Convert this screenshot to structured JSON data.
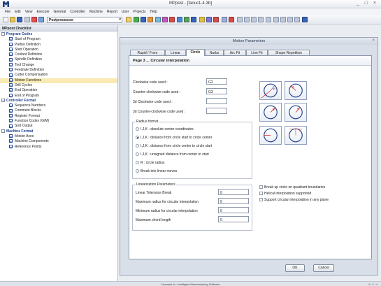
{
  "window": {
    "title": "MPpost - [fanuc1-4-3b]",
    "controls": "_ □ ×"
  },
  "menu": [
    "File",
    "Edit",
    "View",
    "Execute",
    "General",
    "Controller",
    "Machine",
    "Report",
    "User",
    "Projects",
    "Help"
  ],
  "toolbar": {
    "postprocessor_combo": "Postprocessor"
  },
  "left_panel": {
    "title": "MPpost Checklist",
    "groups": [
      {
        "label": "Program Codes",
        "items": [
          "Start of Program",
          "Partno Definition",
          "Start Operation",
          "Coolant Definition",
          "Spindle Definition",
          "Tool Change",
          "Feedrate Definition",
          "Cutter Compensation",
          "Motion Functions",
          "Drill Cycles",
          "End Operation",
          "End of Program"
        ]
      },
      {
        "label": "Controller Format",
        "items": [
          "Sequence Numbers",
          "Comment Blocks",
          "Register Format",
          "Function Codes (G/M)",
          "Sort Output"
        ]
      },
      {
        "label": "Machine Format",
        "items": [
          "Motion Axes",
          "Machine Components",
          "Reference Points"
        ]
      }
    ]
  },
  "dialog": {
    "title": "Motion Parameters",
    "tabs": [
      "Rapid / From",
      "Linear",
      "Circle",
      "Nurbs",
      "Arc Fit",
      "Line Fit",
      "Shape Repetition"
    ],
    "page_heading": "Page 3 ... Circular interpolation",
    "fields": {
      "cw_label": "Clockwise code used :",
      "cw_value": "G2",
      "ccw_label": "Counter-clockwise code used :",
      "ccw_value": "G3",
      "cw3d_label": "3d Clockwise code used :",
      "cw3d_value": "",
      "ccw3d_label": "3d Counter-clockwise code used :",
      "ccw3d_value": ""
    },
    "radius_format": {
      "legend": "Radius format",
      "options": [
        "I,J,K : absolute center coordinates",
        "I,J,K : distance from circle start to circle center",
        "I,J,K : distance from circle center to circle start",
        "I,J,K : unsigned distance from center to start",
        "R : circle radius",
        "Break into linear moves"
      ],
      "selected_index": 1
    },
    "linearization": {
      "legend": "Linearization Parameters",
      "rows": [
        {
          "label": "Linear Tolerance Break",
          "value": "0"
        },
        {
          "label": "Maximum radius for circular interpolation",
          "value": "0"
        },
        {
          "label": "Minimum radius for circular interpolation",
          "value": "0"
        },
        {
          "label": "Maximum chord length",
          "value": "0"
        }
      ]
    },
    "checkboxes": [
      "Break up circle on quadrant boundaries",
      "Helical interpolation supported",
      "Support circular interpolation in any plane"
    ],
    "diagram_labels": {
      "ijk": "ijk",
      "r": "r"
    },
    "buttons": {
      "ok": "OK",
      "cancel": "Cancel"
    }
  },
  "status": {
    "text": "Licensed to : Intelligent Manufacturing Software",
    "right": "4 / 3 / 4"
  },
  "colors": {
    "accent": "#2b4fa0",
    "selection": "#f8eab2",
    "diagram_red": "#d11b1b"
  }
}
